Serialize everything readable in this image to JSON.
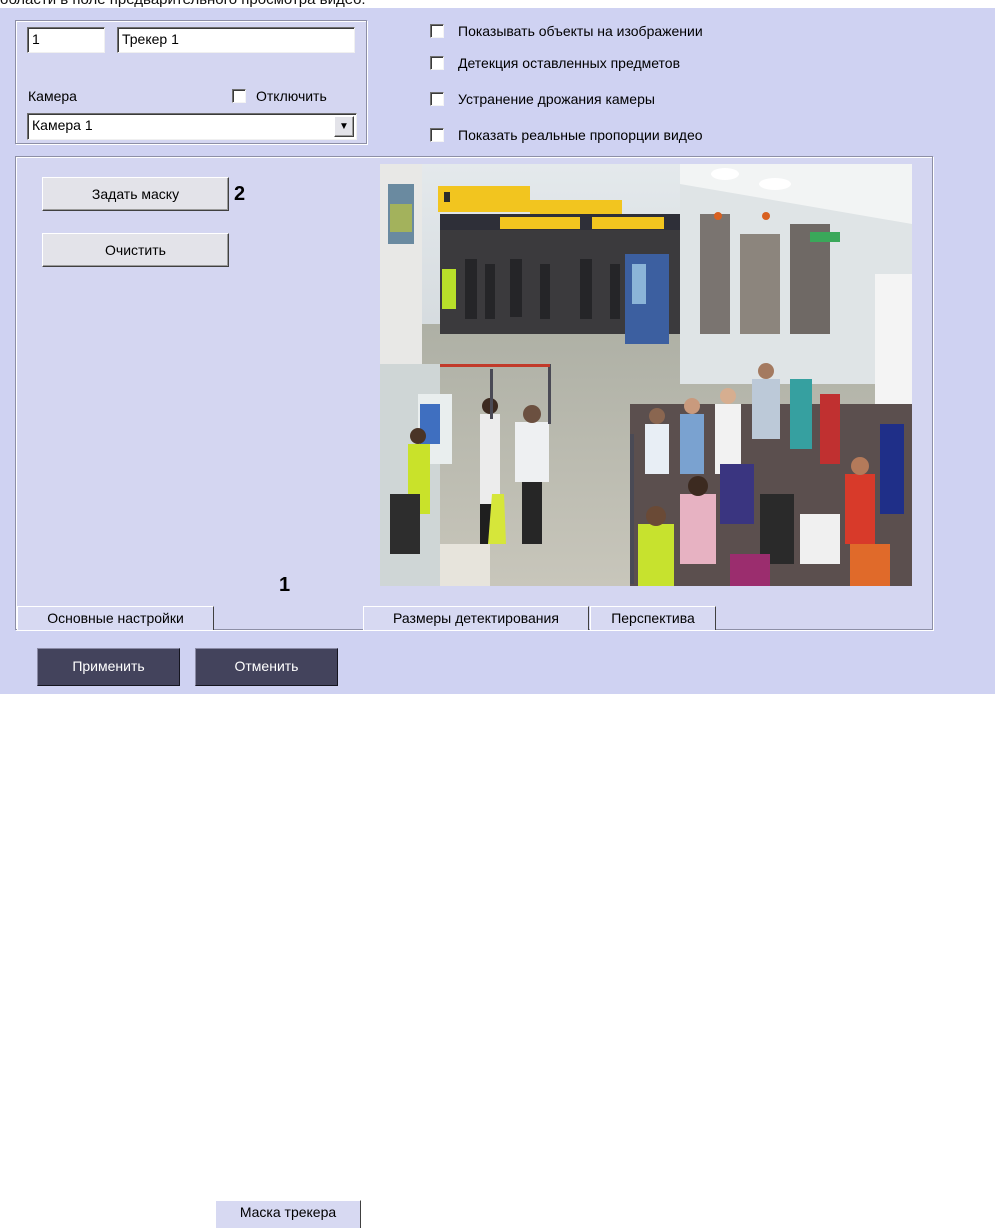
{
  "caption": "области в поле предварительного просмотра видео.",
  "tracker": {
    "id_value": "1",
    "name_value": "Трекер 1"
  },
  "camera": {
    "label": "Камера",
    "disable_label": "Отключить",
    "selected": "Камера 1"
  },
  "options": [
    "Показывать объекты на изображении",
    "Детекция оставленных предметов",
    "Устранение дрожания камеры",
    "Показать реальные пропорции видео"
  ],
  "mask": {
    "set_mask_label": "Задать маску",
    "clear_label": "Очистить"
  },
  "annotations": {
    "tabs_marker": "1",
    "button_marker": "2"
  },
  "tabs": [
    "Основные настройки",
    "Маска трекера",
    "Размеры детектирования",
    "Перспектива"
  ],
  "active_tab": "Маска трекера",
  "footer": {
    "apply_label": "Применить",
    "cancel_label": "Отменить"
  },
  "colors": {
    "dialog_bg": "#cfd2f2",
    "footer_button": "#43435c"
  },
  "icons": {
    "dropdown": "chevron-down-icon"
  }
}
